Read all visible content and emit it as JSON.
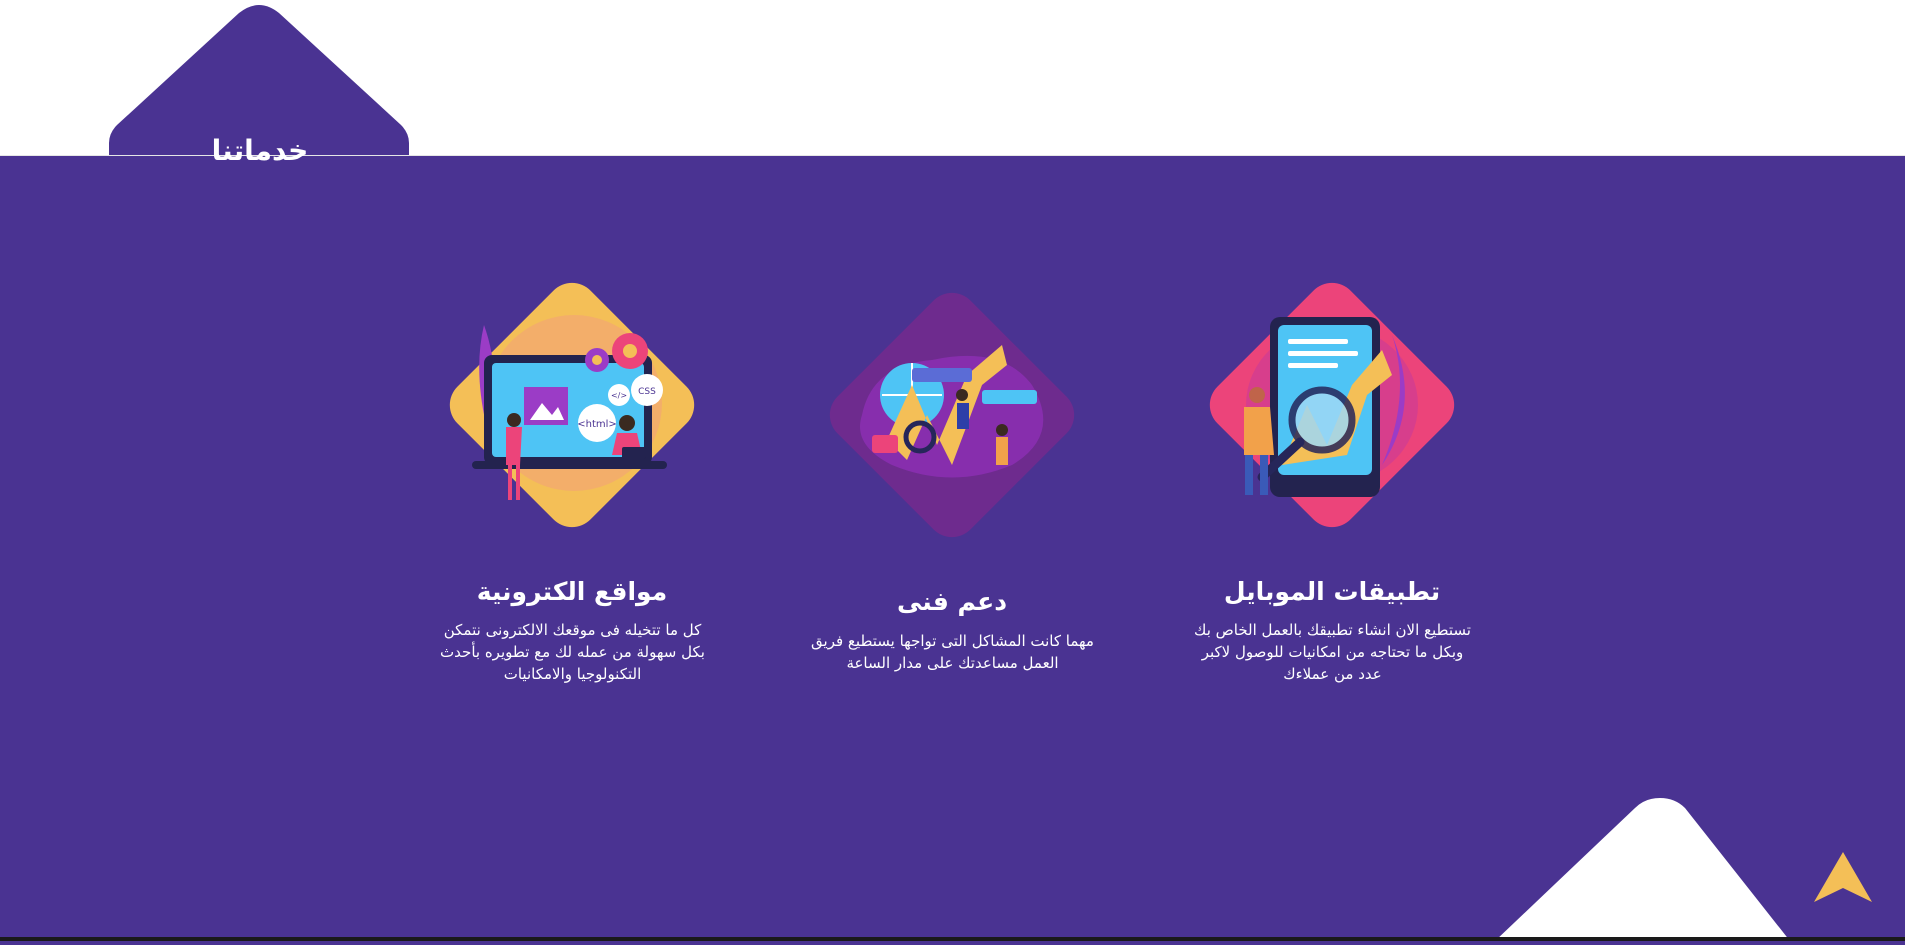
{
  "section": {
    "title": "خدماتنا"
  },
  "colors": {
    "background": "#4a3392",
    "header": "#ffffff",
    "card_mobile": "#ec447a",
    "card_support": "#6e2b8e",
    "card_web": "#f4bf57",
    "scroll_top": "#f4bf57"
  },
  "services": [
    {
      "id": "mobile",
      "title": "تطبيقات الموبايل",
      "description": "تستطيع الان انشاء تطبيقك بالعمل الخاص بك وبكل ما تحتاجه من امكانيات للوصول لاكبر عدد من عملاءك",
      "icon": "mobile-app-illustration"
    },
    {
      "id": "support",
      "title": "دعم فنى",
      "description": "مهما كانت المشاكل التى تواجها يستطيع فريق العمل مساعدتك على مدار الساعة",
      "icon": "support-illustration"
    },
    {
      "id": "web",
      "title": "مواقع الكترونية",
      "description": "كل ما تتخيله فى موقعك الالكترونى نتمكن بكل سهولة من عمله لك مع تطويره بأحدث التكنولوجيا والامكانيات",
      "icon": "website-illustration",
      "tags": [
        "<html>",
        "CSS",
        "</>"
      ]
    }
  ],
  "scroll_top": {
    "icon": "arrow-up-icon"
  }
}
